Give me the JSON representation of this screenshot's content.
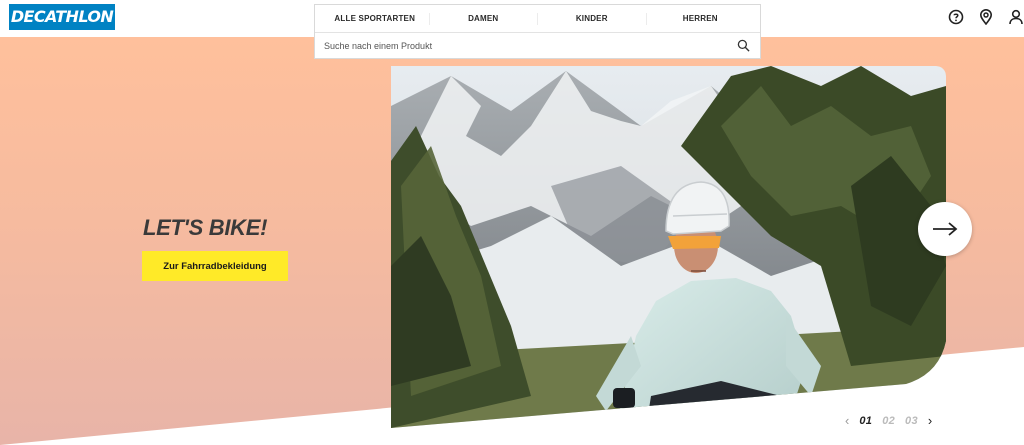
{
  "header": {
    "logo_text": "DECATHLON",
    "icons": [
      "help-icon",
      "store-locator-icon",
      "account-icon"
    ],
    "brand_color": "#0082c3"
  },
  "nav": {
    "tabs": [
      "ALLE SPORTARTEN",
      "DAMEN",
      "KINDER",
      "HERREN"
    ],
    "search_placeholder": "Suche nach einem Produkt"
  },
  "hero": {
    "headline": "LET'S BIKE!",
    "cta_label": "Zur Fahrradbekleidung",
    "cta_color": "#ffea28",
    "background_color": "#ffc09c",
    "image_subject": "cyclist in light jersey in front of snowy mountains and pine trees"
  },
  "carousel": {
    "pages": [
      "01",
      "02",
      "03"
    ],
    "active_page": "01"
  }
}
